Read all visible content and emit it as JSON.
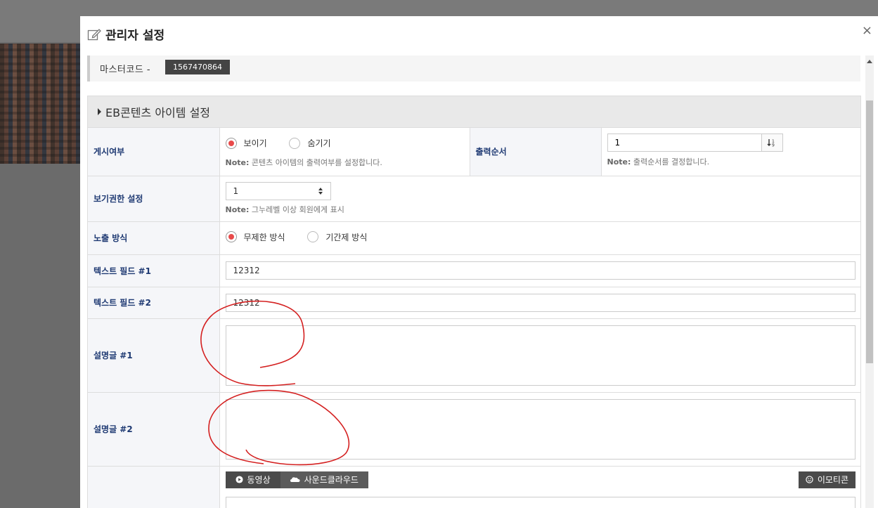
{
  "modal": {
    "title": "관리자 설정",
    "close_label": "×"
  },
  "master": {
    "label": "마스터코드 -",
    "code": "1567470864"
  },
  "panel": {
    "heading": "EB콘텐츠 아이템 설정"
  },
  "fields": {
    "display": {
      "label": "게시여부",
      "options": [
        "보이기",
        "숨기기"
      ],
      "selected": "보이기",
      "note_prefix": "Note:",
      "note": "콘텐츠 아이템의 출력여부를 설정합니다."
    },
    "order": {
      "label": "출력순서",
      "value": "1",
      "note_prefix": "Note:",
      "note": "출력순서를 결정합니다."
    },
    "permission": {
      "label": "보기권한 설정",
      "value": "1",
      "note_prefix": "Note:",
      "note": "그누레벨 이상 회원에게 표시"
    },
    "exposure": {
      "label": "노출 방식",
      "options": [
        "무제한 방식",
        "기간제 방식"
      ],
      "selected": "무제한 방식"
    },
    "text1": {
      "label": "텍스트 필드 #1",
      "value": "12312"
    },
    "text2": {
      "label": "텍스트 필드 #2",
      "value": "12312"
    },
    "desc1": {
      "label": "설명글 #1"
    },
    "desc2": {
      "label": "설명글 #2"
    },
    "media": {
      "video_label": "동영상",
      "soundcloud_label": "사운드클라우드",
      "emoticon_label": "이모티콘"
    }
  },
  "colors": {
    "radio_selected": "#e84a4a",
    "label_text": "#1f3a73",
    "annotation": "#d42020"
  }
}
